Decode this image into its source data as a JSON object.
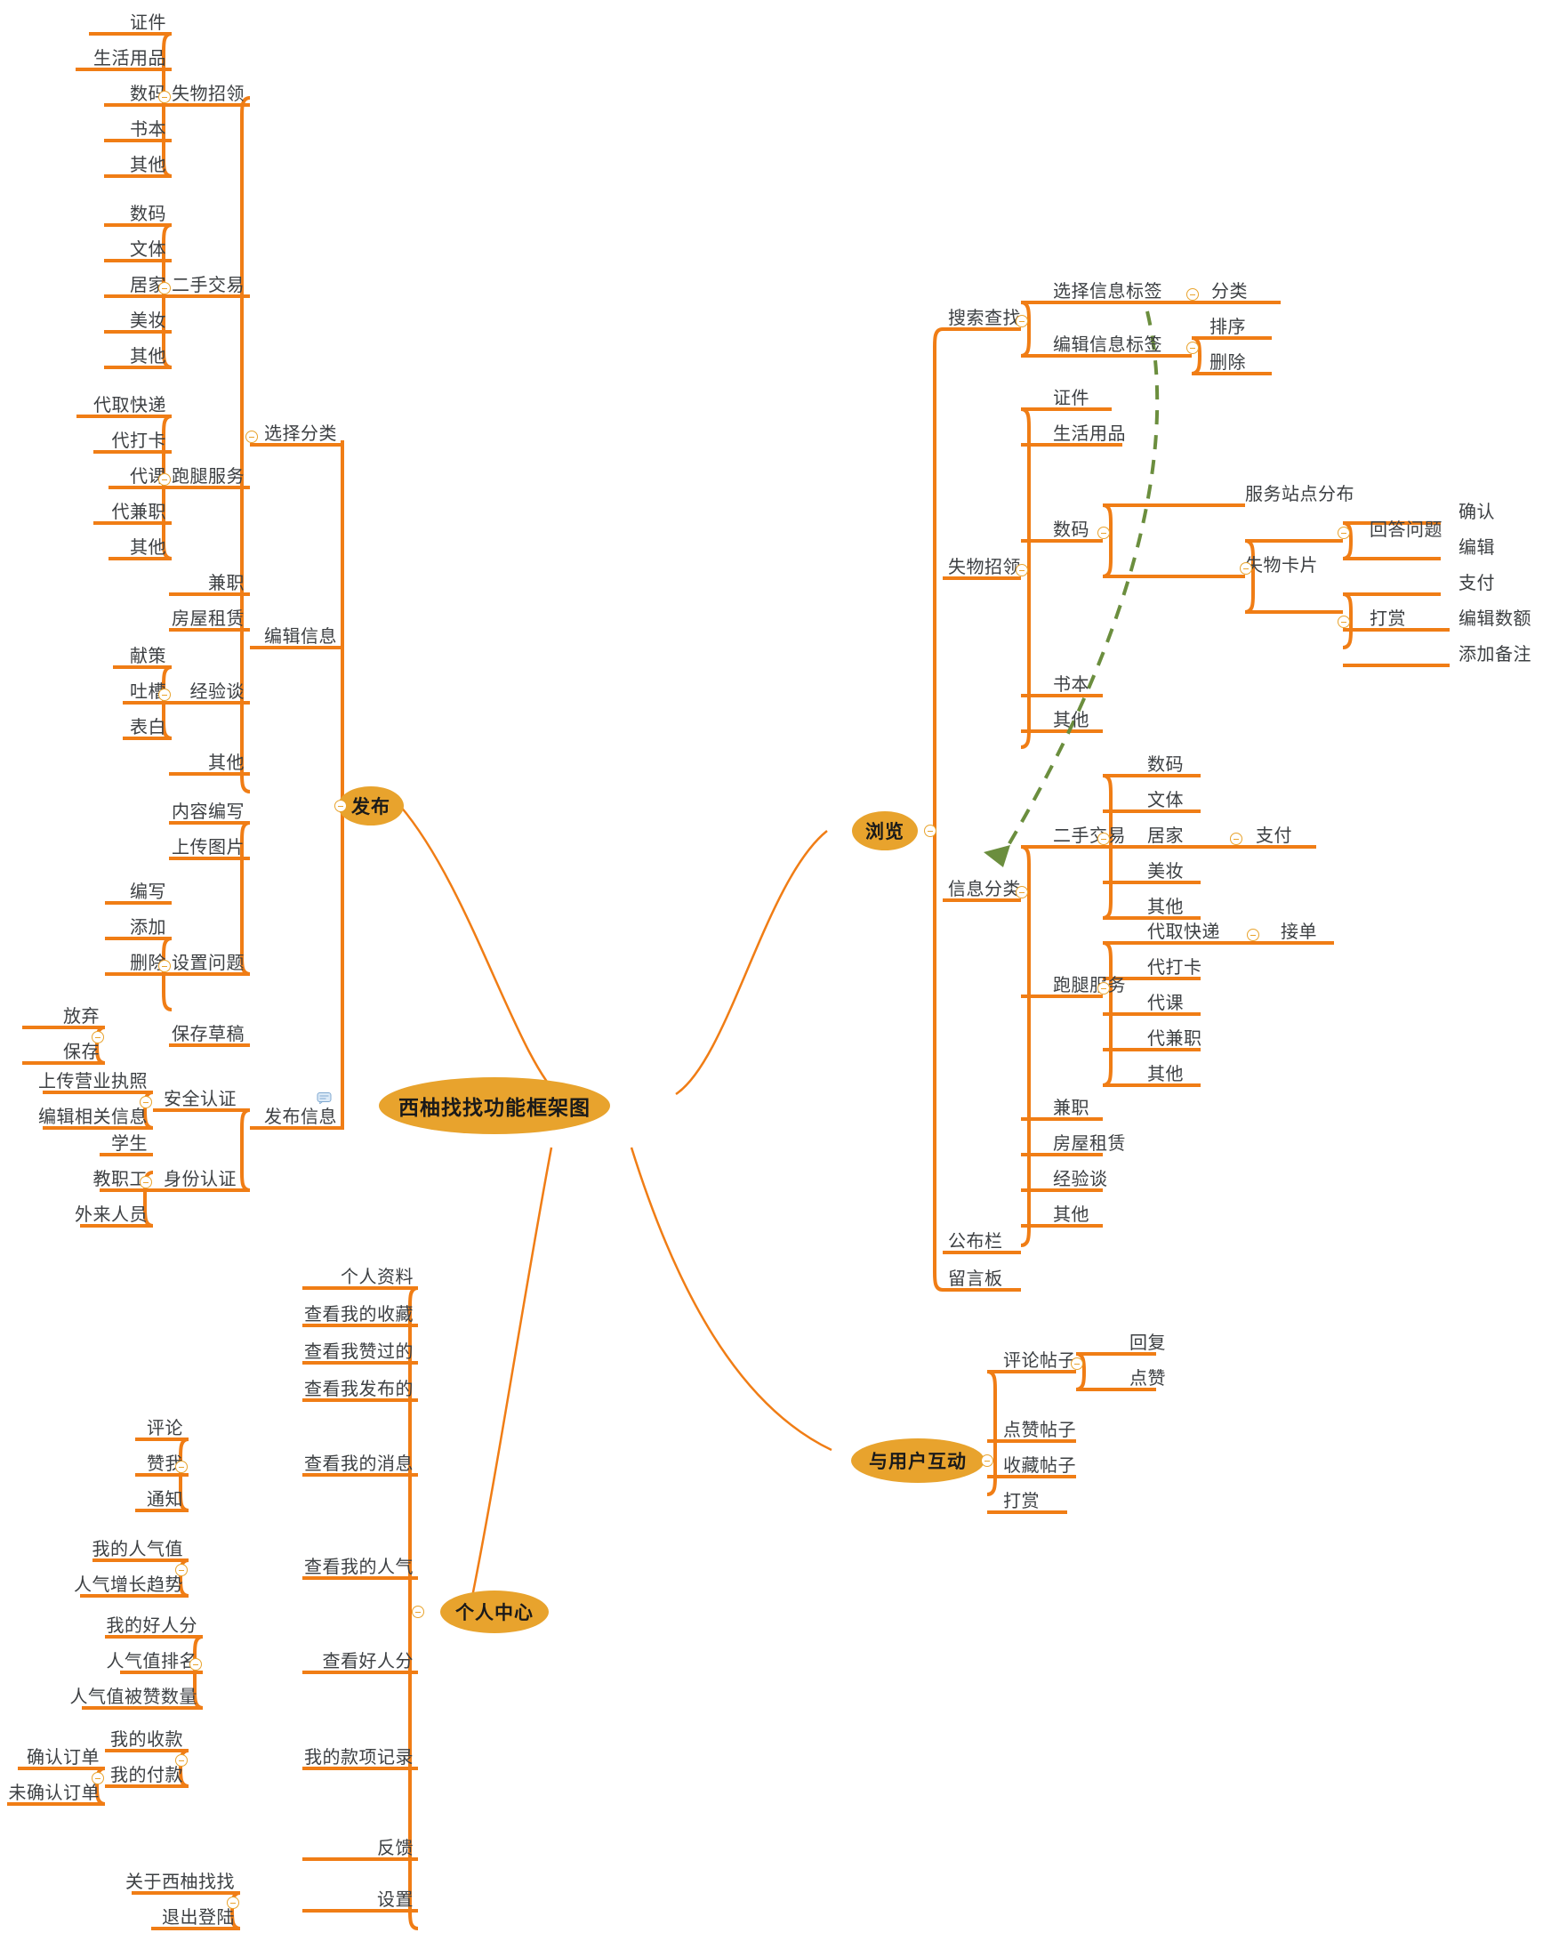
{
  "diagram": {
    "title": "西柚找找功能框架图",
    "accent_color": "#F07D15",
    "node_fill": "#E8A32D",
    "text_color": "#3d4043",
    "dashed_link_color": "#6B8E3E",
    "root": "西柚找找功能框架图",
    "branches": {
      "publish": "发布",
      "browse": "浏览",
      "interact": "与用户互动",
      "profile": "个人中心"
    }
  },
  "publish": {
    "label": "发布",
    "select_category": "选择分类",
    "lost_found": "失物招领",
    "lost_found_items": [
      "证件",
      "生活用品",
      "数码",
      "书本",
      "其他"
    ],
    "second_hand": "二手交易",
    "second_hand_items": [
      "数码",
      "文体",
      "居家",
      "美妆",
      "其他"
    ],
    "errand": "跑腿服务",
    "errand_items": [
      "代取快递",
      "代打卡",
      "代课",
      "代兼职",
      "其他"
    ],
    "part_time": "兼职",
    "house_rent": "房屋租赁",
    "experience": "经验谈",
    "experience_items": [
      "献策",
      "吐槽",
      "表白"
    ],
    "other": "其他",
    "edit_info": "编辑信息",
    "content_write": "内容编写",
    "upload_image": "上传图片",
    "set_question": "设置问题",
    "set_question_items": [
      "编写",
      "添加",
      "删除"
    ],
    "save_draft": "保存草稿",
    "save_draft_items": [
      "放弃",
      "保存"
    ],
    "publish_info": "发布信息",
    "security_auth": "安全认证",
    "security_auth_items": [
      "上传营业执照",
      "编辑相关信息"
    ],
    "security_auth_note_icon": "note-icon",
    "identity_auth": "身份认证",
    "identity_auth_items": [
      "学生",
      "教职工",
      "外来人员"
    ]
  },
  "browse": {
    "label": "浏览",
    "search": "搜索查找",
    "select_tag": "选择信息标签",
    "select_tag_items": [
      "分类"
    ],
    "edit_tag": "编辑信息标签",
    "edit_tag_items": [
      "排序",
      "删除"
    ],
    "lost_found": "失物招领",
    "lost_found_items": [
      "证件",
      "生活用品",
      "数码",
      "书本",
      "其他"
    ],
    "digital_label": "数码",
    "service_stations": "服务站点分布",
    "lost_card": "失物卡片",
    "answer_question": "回答问题",
    "answer_question_items": [
      "确认",
      "编辑"
    ],
    "reward": "打赏",
    "reward_items": [
      "支付",
      "编辑数额",
      "添加备注"
    ],
    "info_category": "信息分类",
    "second_hand": "二手交易",
    "second_hand_items": [
      "数码",
      "文体",
      "居家",
      "美妆",
      "其他"
    ],
    "payment": "支付",
    "errand": "跑腿服务",
    "errand_items": [
      "代取快递",
      "代打卡",
      "代课",
      "代兼职",
      "其他"
    ],
    "take_order": "接单",
    "part_time": "兼职",
    "house_rent": "房屋租赁",
    "experience": "经验谈",
    "other": "其他",
    "bulletin": "公布栏",
    "message_board": "留言板"
  },
  "interact": {
    "label": "与用户互动",
    "comment_post": "评论帖子",
    "comment_post_items": [
      "回复",
      "点赞"
    ],
    "like_post": "点赞帖子",
    "collect_post": "收藏帖子",
    "reward": "打赏"
  },
  "profile": {
    "label": "个人中心",
    "personal_data": "个人资料",
    "my_collection": "查看我的收藏",
    "my_likes": "查看我赞过的",
    "my_posts": "查看我发布的",
    "my_messages": "查看我的消息",
    "my_messages_items": [
      "评论",
      "赞我",
      "通知"
    ],
    "my_popularity": "查看我的人气",
    "my_popularity_items": [
      "我的人气值",
      "人气增长趋势"
    ],
    "my_goodness": "查看好人分",
    "my_goodness_items": [
      "我的好人分",
      "人气值排名",
      "人气值被赞数量"
    ],
    "my_payments": "我的款项记录",
    "my_income": "我的收款",
    "my_payment": "我的付款",
    "my_payment_items": [
      "确认订单",
      "未确认订单"
    ],
    "feedback": "反馈",
    "settings": "设置",
    "settings_items": [
      "关于西柚找找",
      "退出登陆"
    ]
  }
}
